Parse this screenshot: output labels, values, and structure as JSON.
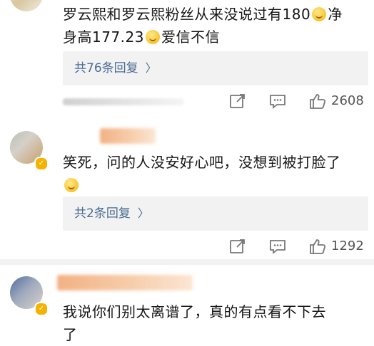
{
  "comments": [
    {
      "line1": "罗云熙和罗云熙粉丝从来没说过有180",
      "line2_a": "净",
      "line2_b": "身高177.23",
      "line2_c": "爱信不信",
      "replies": "共76条回复",
      "likes": "2608"
    },
    {
      "text": "笑死，问的人没安好心吧，没想到被打脸了",
      "replies": "共2条回复",
      "likes": "1292"
    },
    {
      "text": "我说你们别太离谱了，真的有点看不下去",
      "tail": "了"
    }
  ],
  "icons": {
    "share": "share-icon",
    "comment": "comment-icon",
    "like": "thumbs-up-icon",
    "chevron": "chevron-right-icon"
  },
  "colors": {
    "link": "#4c6b94",
    "reply_bg": "#f2f2f2",
    "badge": "#f5b300"
  }
}
